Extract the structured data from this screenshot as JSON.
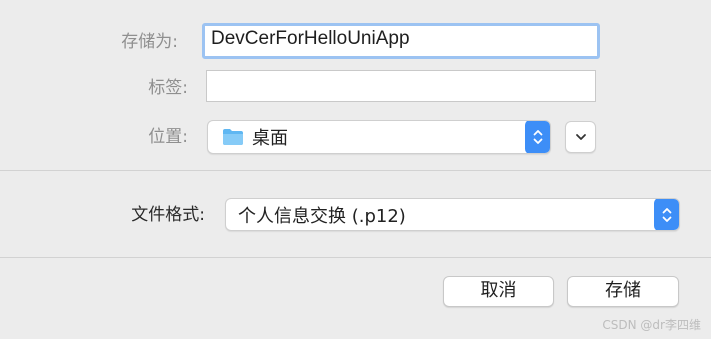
{
  "save_as": {
    "label": "存储为:",
    "value": "DevCerForHelloUniApp"
  },
  "tags": {
    "label": "标签:",
    "value": ""
  },
  "location": {
    "label": "位置:",
    "value": "桌面",
    "icon": "folder-icon"
  },
  "file_format": {
    "label": "文件格式:",
    "value": "个人信息交换 (.p12)"
  },
  "buttons": {
    "cancel": "取消",
    "save": "存储"
  },
  "watermark": "CSDN @dr李四维",
  "colors": {
    "accent": "#3d8ef7",
    "focus_ring": "#9cc3f2",
    "folder": "#5fb7f2"
  }
}
